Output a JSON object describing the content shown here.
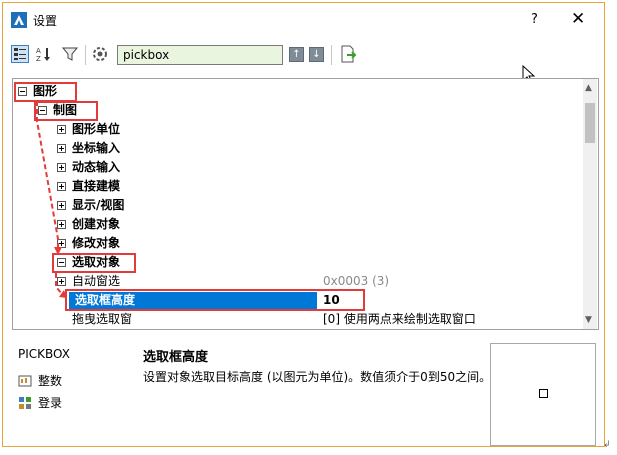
{
  "window": {
    "title": "设置",
    "help": "?",
    "close": "✕"
  },
  "toolbar": {
    "search_value": "pickbox",
    "up": "↑",
    "down": "↓"
  },
  "tree": {
    "rows": [
      {
        "label": "图形",
        "toggle": "minus",
        "bold": true
      },
      {
        "label": "制图",
        "toggle": "minus",
        "bold": true
      },
      {
        "label": "图形单位",
        "toggle": "plus",
        "bold": true
      },
      {
        "label": "坐标输入",
        "toggle": "plus",
        "bold": true
      },
      {
        "label": "动态输入",
        "toggle": "plus",
        "bold": true
      },
      {
        "label": "直接建模",
        "toggle": "plus",
        "bold": true
      },
      {
        "label": "显示/视图",
        "toggle": "plus",
        "bold": true
      },
      {
        "label": "创建对象",
        "toggle": "plus",
        "bold": true
      },
      {
        "label": "修改对象",
        "toggle": "plus",
        "bold": true
      },
      {
        "label": "选取对象",
        "toggle": "minus",
        "bold": true
      },
      {
        "label": "自动窗选",
        "toggle": "plus",
        "bold": false,
        "value": "0x0003 (3)",
        "dim": true
      },
      {
        "label": "选取框高度",
        "toggle": "",
        "bold": true,
        "value": "10",
        "selected": true
      },
      {
        "label": "拖曳选取窗",
        "toggle": "",
        "bold": false,
        "value": "[0] 使用两点来绘制选取窗口"
      }
    ]
  },
  "info": {
    "command": "PICKBOX",
    "type_label": "整数",
    "registry_label": "登录",
    "prop_title": "选取框高度",
    "prop_desc": "设置对象选取目标高度 (以图元为单位)。数值须介于0到50之间。"
  },
  "colors": {
    "accent": "#0078d7",
    "highlight": "#e23b3b",
    "search_bg": "#eaf5e0"
  }
}
